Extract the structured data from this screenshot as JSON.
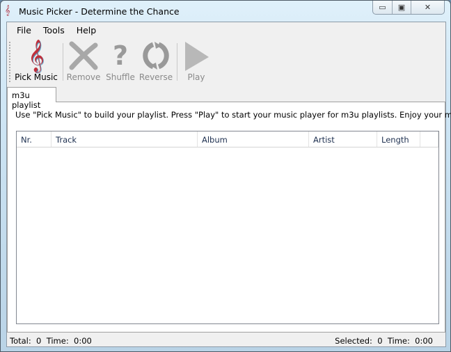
{
  "window": {
    "title": "Music Picker - Determine the Chance",
    "controls": {
      "minimize": "▭",
      "maximize": "▣",
      "close": "✕"
    }
  },
  "menu": [
    "File",
    "Tools",
    "Help"
  ],
  "toolbar": [
    {
      "label": "Pick Music",
      "icon": "treble-clef-icon",
      "enabled": true
    },
    {
      "label": "Remove",
      "icon": "x-icon",
      "enabled": false
    },
    {
      "label": "Shuffle",
      "icon": "question-mark-icon",
      "enabled": false
    },
    {
      "label": "Reverse",
      "icon": "refresh-icon",
      "enabled": false
    },
    {
      "label": "Play",
      "icon": "play-icon",
      "enabled": false
    }
  ],
  "tabs": [
    "m3u playlist"
  ],
  "description": "Use \"Pick Music\" to build your playlist. Press \"Play\" to start your music player for m3u playlists. Enjoy your music.",
  "columns": [
    "Nr.",
    "Track",
    "Album",
    "Artist",
    "Length"
  ],
  "rows": [],
  "status": {
    "total_label": "Total:",
    "total": "0",
    "time_label": "Time:",
    "time": "0:00",
    "selected_label": "Selected:",
    "selected": "0",
    "selected_time": "0:00"
  }
}
